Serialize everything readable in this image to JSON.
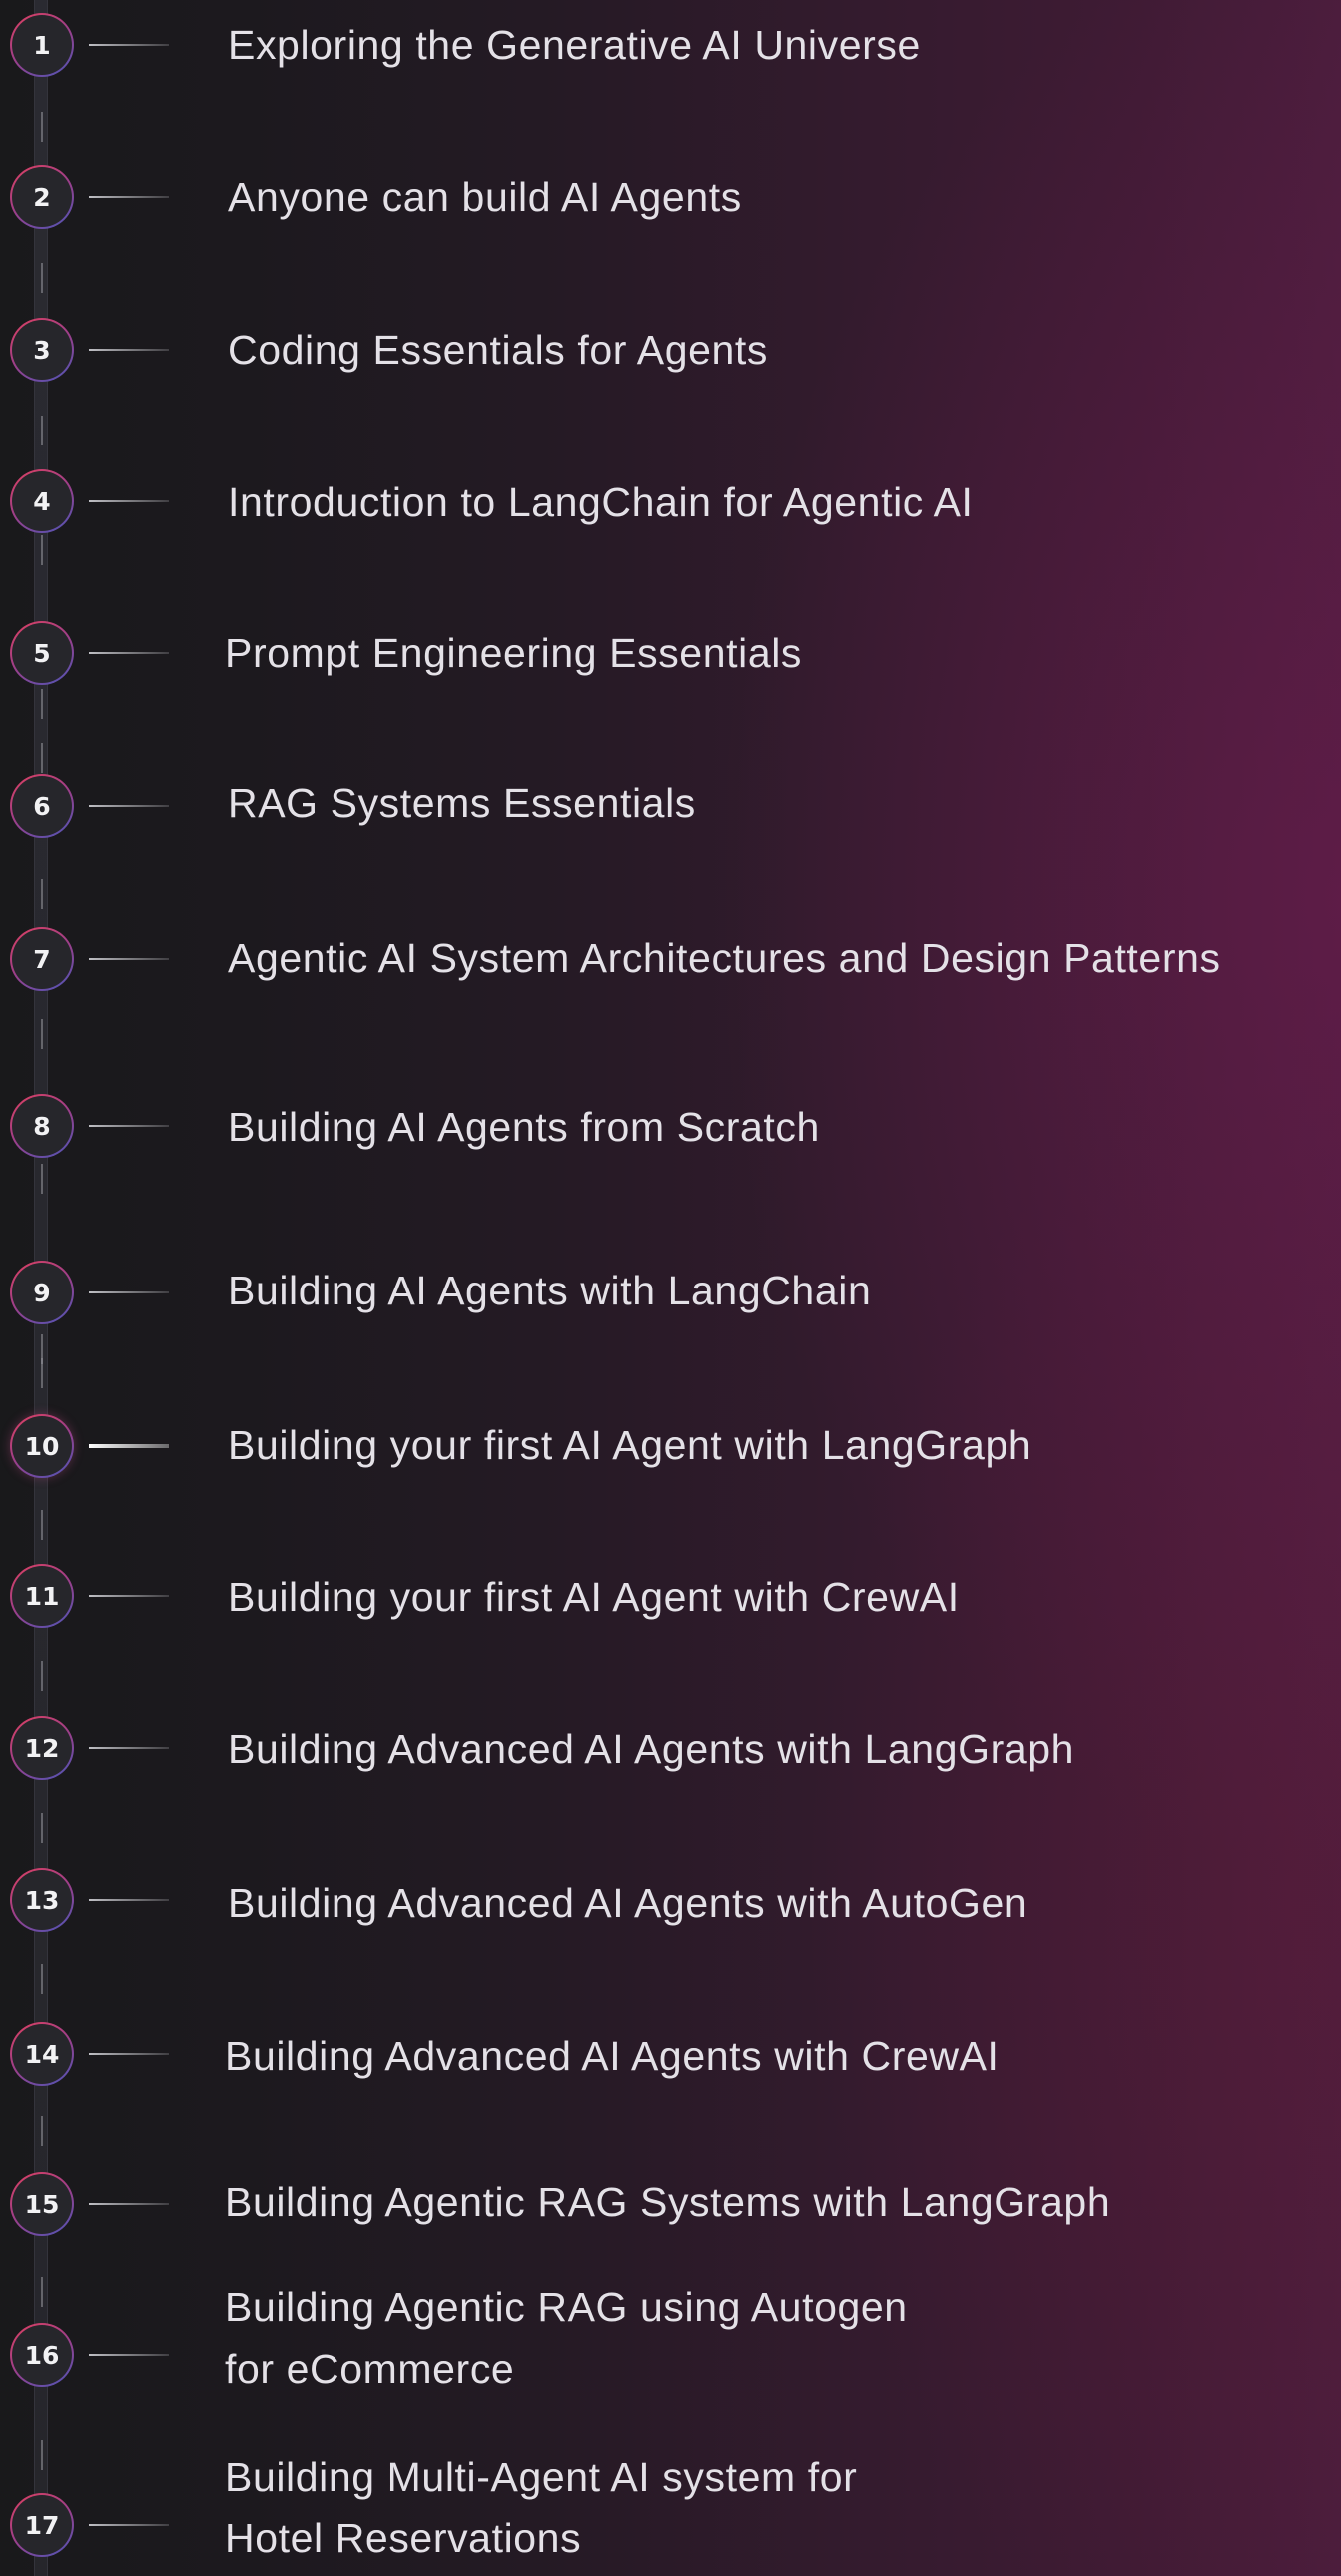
{
  "modules": [
    {
      "number": "1",
      "title": "Exploring the Generative AI Universe"
    },
    {
      "number": "2",
      "title": "Anyone can build AI Agents"
    },
    {
      "number": "3",
      "title": "Coding Essentials for Agents"
    },
    {
      "number": "4",
      "title": "Introduction to LangChain for Agentic AI"
    },
    {
      "number": "5",
      "title": "Prompt Engineering Essentials"
    },
    {
      "number": "6",
      "title": "RAG Systems Essentials"
    },
    {
      "number": "7",
      "title": "Agentic AI System Architectures and Design Patterns"
    },
    {
      "number": "8",
      "title": "Building AI Agents from Scratch"
    },
    {
      "number": "9",
      "title": "Building AI Agents with LangChain"
    },
    {
      "number": "10",
      "title": "Building your first AI Agent with LangGraph"
    },
    {
      "number": "11",
      "title": "Building your first AI Agent with CrewAI"
    },
    {
      "number": "12",
      "title": "Building Advanced AI Agents with LangGraph"
    },
    {
      "number": "13",
      "title": "Building Advanced AI Agents with AutoGen"
    },
    {
      "number": "14",
      "title": "Building Advanced AI Agents with CrewAI"
    },
    {
      "number": "15",
      "title": "Building Agentic RAG Systems with LangGraph"
    },
    {
      "number": "16",
      "title_line1": "Building Agentic RAG using Autogen",
      "title_line2": "for eCommerce"
    },
    {
      "number": "17",
      "title_line1": "Building Multi-Agent AI system for",
      "title_line2": "Hotel Reservations"
    }
  ],
  "active_module": "10",
  "colors": {
    "circle_gradient_start": "#e0405f",
    "circle_gradient_end": "#4a56b8",
    "text": "#e4e1e7",
    "background_left": "#19191b",
    "background_right": "#4a1d3c"
  }
}
